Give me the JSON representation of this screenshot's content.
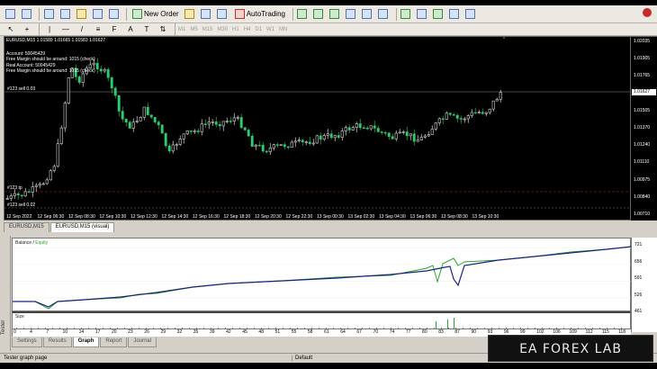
{
  "toolbar": {
    "new_order": "New Order",
    "autotrading": "AutoTrading",
    "timeframes": [
      "M1",
      "M5",
      "M15",
      "M30",
      "H1",
      "H4",
      "D1",
      "W1",
      "MN"
    ]
  },
  "chart": {
    "header": "EURUSD,M15  1.01589 1.01665 1.01583 1.01627",
    "account_lines": [
      "Account: 50045429",
      "Free Margin should be around: 1015 (check)",
      "Real Account: 50045429",
      "Free Margin should be around: 1015 (check)"
    ],
    "order_label_sell": "#123 sell 0.03",
    "order_label_tp": "#123 tp",
    "order_label_sell2": "#123 sell 0.02",
    "price_labels": [
      "1.02035",
      "1.01905",
      "1.01765",
      "1.01627",
      "1.01505",
      "1.01370",
      "1.01240",
      "1.01110",
      "1.00975",
      "1.00840",
      "1.00710"
    ],
    "current_price": "1.01627",
    "time_labels": [
      "12 Sep 2022",
      "12 Sep 06:30",
      "12 Sep 08:30",
      "12 Sep 10:30",
      "12 Sep 12:30",
      "12 Sep 14:30",
      "12 Sep 16:30",
      "12 Sep 18:30",
      "12 Sep 20:30",
      "12 Sep 22:30",
      "13 Sep 00:30",
      "13 Sep 02:30",
      "13 Sep 04:30",
      "13 Sep 06:30",
      "13 Sep 08:30",
      "13 Sep 10:30"
    ]
  },
  "chart_tabs": [
    "EURUSD,M15",
    "EURUSD,M15 (visual)"
  ],
  "tester": {
    "side_label": "Tester",
    "legend_balance": "Balance",
    "legend_equity": "Equity",
    "size_label": "Size",
    "y_labels": [
      "721",
      "656",
      "591",
      "526",
      "461"
    ],
    "x_labels": [
      "0",
      "4",
      "7",
      "10",
      "14",
      "17",
      "20",
      "23",
      "26",
      "29",
      "32",
      "35",
      "39",
      "42",
      "45",
      "48",
      "51",
      "55",
      "58",
      "61",
      "64",
      "67",
      "70",
      "74",
      "77",
      "80",
      "83",
      "87",
      "90",
      "93",
      "96",
      "99",
      "102",
      "106",
      "109",
      "112",
      "115",
      "118"
    ],
    "tabs": [
      "Settings",
      "Results",
      "Graph",
      "Report",
      "Journal"
    ],
    "active_tab": "Graph"
  },
  "status": {
    "left": "Tester graph page",
    "profile": "Default"
  },
  "watermark": "EA FOREX LAB",
  "colors": {
    "balance": "#1a237e",
    "equity": "#2aa52a",
    "bull": "#ffffff",
    "bear": "#2ecc71"
  }
}
